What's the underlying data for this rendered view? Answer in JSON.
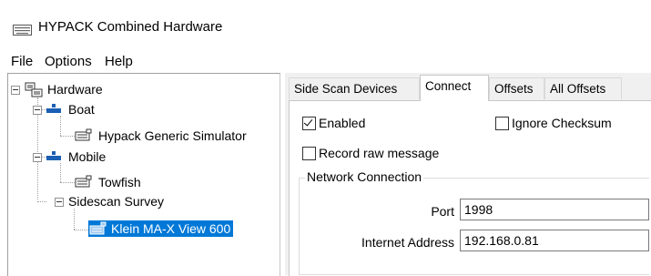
{
  "window": {
    "title": "HYPACK Combined Hardware",
    "icon": "keyboard-icon"
  },
  "menu": [
    "File",
    "Options",
    "Help"
  ],
  "tree": {
    "root": "Hardware",
    "boat": "Boat",
    "boat_child": "Hypack Generic Simulator",
    "mobile": "Mobile",
    "mobile_child": "Towfish",
    "sidescan": "Sidescan Survey",
    "sidescan_child": "Klein MA-X View 600"
  },
  "tabs": [
    "Side Scan Devices",
    "Connect",
    "Offsets",
    "All Offsets"
  ],
  "active_tab": "Connect",
  "connect": {
    "enabled_label": "Enabled",
    "enabled": true,
    "ignore_checksum_label": "Ignore Checksum",
    "ignore_checksum": false,
    "record_raw_label": "Record raw message",
    "record_raw": false,
    "network_group": "Network Connection",
    "port_label": "Port",
    "port_value": "1998",
    "address_label": "Internet Address",
    "address_value": "192.168.0.81"
  },
  "colors": {
    "selection": "#0078d7",
    "panel_bg": "#f0f0f0"
  }
}
